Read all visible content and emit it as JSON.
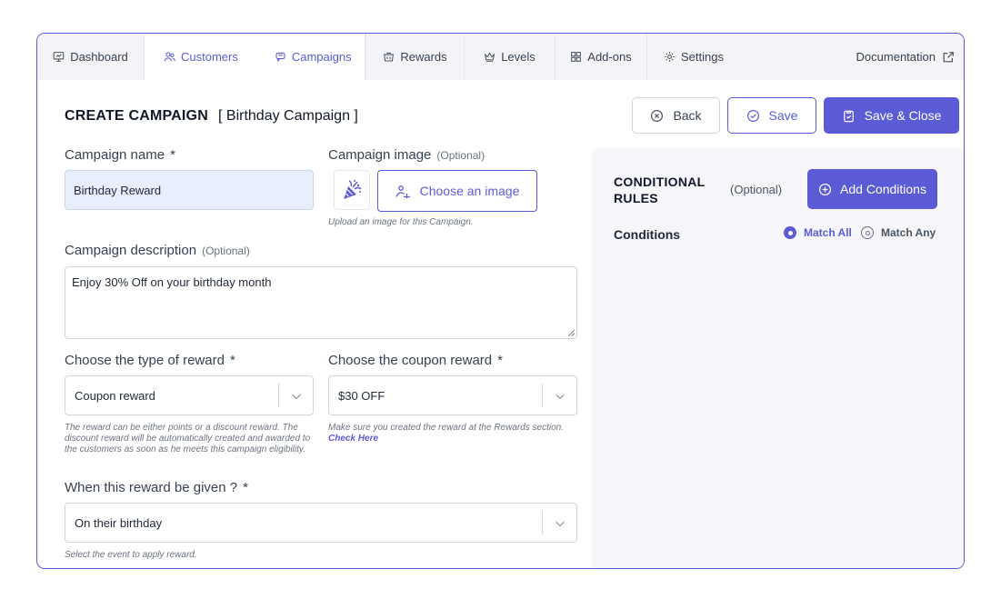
{
  "tabs": [
    {
      "label": "Dashboard",
      "icon": "monitor-icon"
    },
    {
      "label": "Customers",
      "icon": "users-icon"
    },
    {
      "label": "Campaigns",
      "icon": "chat-stack-icon"
    },
    {
      "label": "Rewards",
      "icon": "basket-icon"
    },
    {
      "label": "Levels",
      "icon": "crown-icon"
    },
    {
      "label": "Add-ons",
      "icon": "grid-icon"
    },
    {
      "label": "Settings",
      "icon": "gear-icon"
    }
  ],
  "documentation_label": "Documentation",
  "header": {
    "title": "CREATE CAMPAIGN",
    "subtitle": "[ Birthday Campaign ]",
    "back_label": "Back",
    "save_label": "Save",
    "save_close_label": "Save & Close"
  },
  "form": {
    "campaign_name_label": "Campaign name",
    "required_mark": "*",
    "campaign_name_value": "Birthday Reward",
    "campaign_image_label": "Campaign image",
    "optional_text": "(Optional)",
    "choose_image_label": "Choose an image",
    "image_help": "Upload an image for this Campaign.",
    "description_label": "Campaign description",
    "description_value": "Enjoy 30% Off on your birthday month",
    "reward_type_label": "Choose the type of reward",
    "reward_type_value": "Coupon reward",
    "reward_type_help": "The reward can be either points or a discount reward. The discount reward will be automatically created and awarded to the customers as soon as he meets this campaign eligibility.",
    "coupon_label": "Choose the coupon reward",
    "coupon_value": "$30 OFF",
    "coupon_help": "Make sure you created the reward at the Rewards section.",
    "coupon_help_link": "Check Here",
    "when_label": "When this reward be given ?",
    "when_value": "On their birthday",
    "when_help": "Select the event to apply reward."
  },
  "conditional_rules": {
    "title": "CONDITIONAL RULES",
    "optional_text": "(Optional)",
    "add_label": "Add Conditions",
    "conditions_label": "Conditions",
    "match_all": "Match All",
    "match_any": "Match Any",
    "selected": "Match All"
  },
  "colors": {
    "accent": "#5b5bd6",
    "tab_bg": "#f4f4f8",
    "panel_bg": "#f5f5fa",
    "input_filled": "#e8eefc"
  }
}
